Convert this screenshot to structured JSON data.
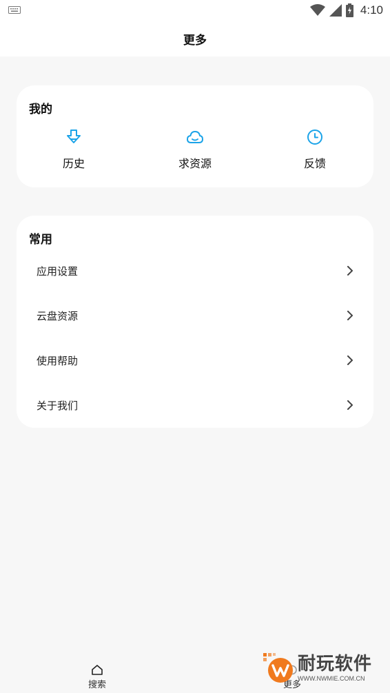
{
  "status_bar": {
    "time": "4:10"
  },
  "header": {
    "title": "更多"
  },
  "mine": {
    "title": "我的",
    "items": [
      {
        "label": "历史",
        "icon": "download-arrow-icon"
      },
      {
        "label": "求资源",
        "icon": "cloud-icon"
      },
      {
        "label": "反馈",
        "icon": "clock-icon"
      }
    ]
  },
  "common": {
    "title": "常用",
    "rows": [
      {
        "label": "应用设置"
      },
      {
        "label": "云盘资源"
      },
      {
        "label": "使用帮助"
      },
      {
        "label": "关于我们"
      }
    ]
  },
  "bottom_nav": {
    "tabs": [
      {
        "label": "搜索",
        "icon": "home-icon"
      },
      {
        "label": "更多",
        "icon": "more-icon"
      }
    ]
  },
  "watermark": {
    "name": "耐玩软件",
    "url": "WWW.NWMIE.COM.CN"
  },
  "colors": {
    "accent": "#1aa3e8",
    "card": "#ffffff",
    "background": "#f7f7f7",
    "watermark_orange": "#f07a1e"
  }
}
